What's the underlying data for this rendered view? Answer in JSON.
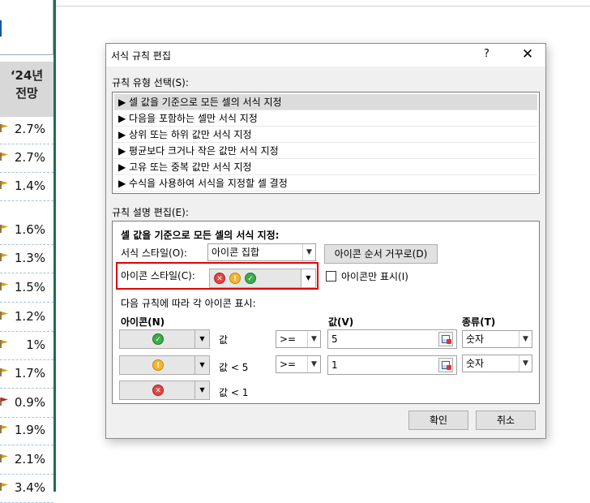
{
  "sheet": {
    "year_header_line1": "‘24년",
    "year_header_line2": "전망",
    "cells": [
      "2.7%",
      "2.7%",
      "1.4%",
      "1.6%",
      "1.3%",
      "1.5%",
      "1.2%",
      "1%",
      "1.7%",
      "0.9%",
      "1.9%",
      "2.1%",
      "3.4%"
    ]
  },
  "dialog": {
    "title": "서식 규칙 편집",
    "help": "?",
    "close": "✕",
    "rule_type_label": "규칙 유형 선택(S):",
    "rule_types": [
      "▶ 셀 값을 기준으로 모든 셀의 서식 지정",
      "▶ 다음을 포함하는 셀만 서식 지정",
      "▶ 상위 또는 하위 값만 서식 지정",
      "▶ 평균보다 크거나 작은 값만 서식 지정",
      "▶ 고유 또는 중복 값만 서식 지정",
      "▶ 수식을 사용하여 서식을 지정할 셀 결정"
    ],
    "desc_label": "규칙 설명 편집(E):",
    "desc_heading": "셀 값을 기준으로 모든 셀의 서식 지정:",
    "format_style_label": "서식 스타일(O):",
    "format_style_value": "아이콘 집합",
    "reverse_button": "아이콘 순서 거꾸로(D)",
    "icon_style_label": "아이콘 스타일(C):",
    "icon_only_label": "아이콘만 표시(I)",
    "rule_caption": "다음 규칙에 따라 각 아이콘 표시:",
    "col_icon": "아이콘(N)",
    "col_value": "값(V)",
    "col_type": "종류(T)",
    "rows": [
      {
        "icon": "green-check",
        "cond": "값",
        "op": ">=",
        "value": "5",
        "type": "숫자"
      },
      {
        "icon": "yellow-exclamation",
        "cond": "값 < 5",
        "op": ">=",
        "value": "1",
        "type": "숫자"
      },
      {
        "icon": "red-x",
        "cond": "값 < 1"
      }
    ],
    "ok": "확인",
    "cancel": "취소"
  },
  "colors": {
    "highlight": "#e00000",
    "excel_green": "#1e7145"
  }
}
